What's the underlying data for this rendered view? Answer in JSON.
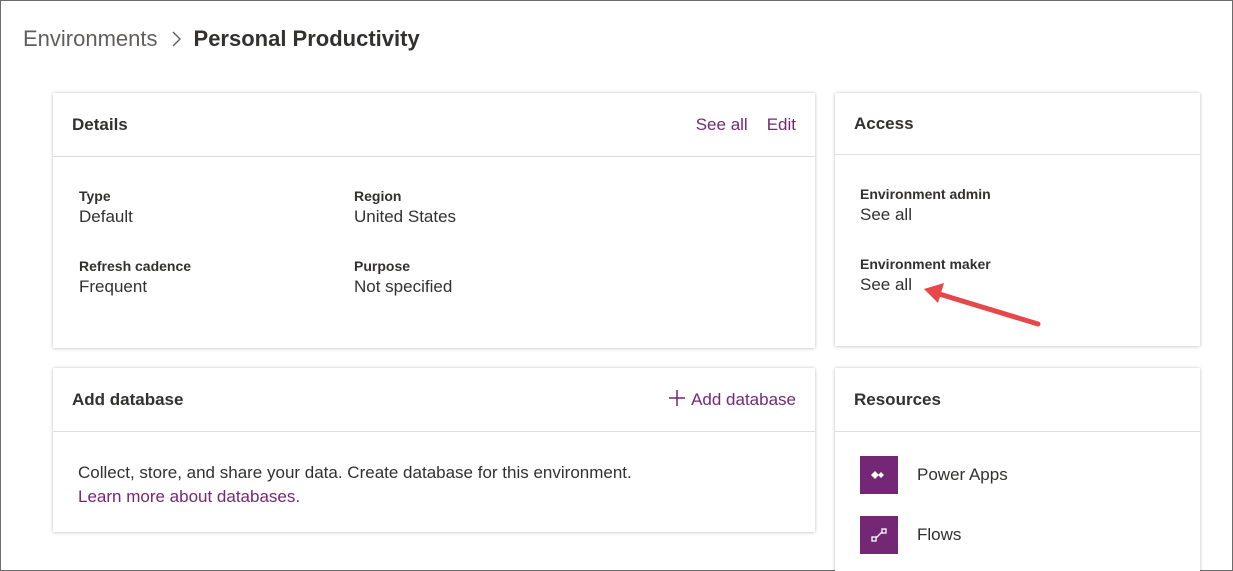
{
  "breadcrumb": {
    "root": "Environments",
    "current": "Personal Productivity"
  },
  "details": {
    "title": "Details",
    "see_all": "See all",
    "edit": "Edit",
    "fields": {
      "type": {
        "label": "Type",
        "value": "Default"
      },
      "region": {
        "label": "Region",
        "value": "United States"
      },
      "refresh": {
        "label": "Refresh cadence",
        "value": "Frequent"
      },
      "purpose": {
        "label": "Purpose",
        "value": "Not specified"
      }
    }
  },
  "access": {
    "title": "Access",
    "admin": {
      "label": "Environment admin",
      "link": "See all"
    },
    "maker": {
      "label": "Environment maker",
      "link": "See all"
    }
  },
  "add_database": {
    "title": "Add database",
    "button": "Add database",
    "description": "Collect, store, and share your data. Create database for this environment.",
    "learn_more": "Learn more about databases."
  },
  "resources": {
    "title": "Resources",
    "items": [
      {
        "label": "Power Apps",
        "icon": "power-apps-icon"
      },
      {
        "label": "Flows",
        "icon": "flows-icon"
      }
    ]
  },
  "colors": {
    "accent": "#742774",
    "annotation_arrow": "#e8474a"
  }
}
